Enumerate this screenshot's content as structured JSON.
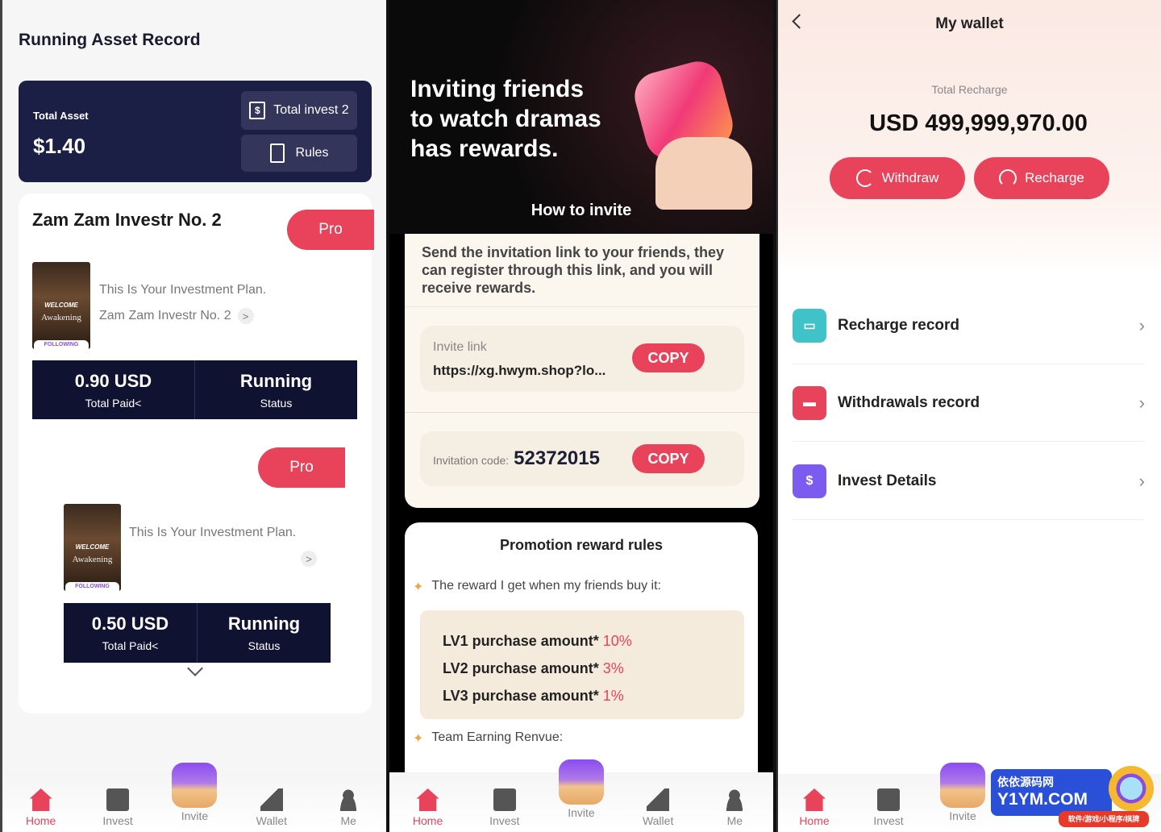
{
  "asset_record": {
    "title": "Running Asset Record",
    "total_asset_label": "Total Asset",
    "total_asset_value": "$1.40",
    "total_invest_label": "Total invest 2",
    "rules_label": "Rules",
    "plans": [
      {
        "name": "Zam Zam Investr No. 2",
        "pro_label": "Pro",
        "description": "This Is Your Investment Plan.",
        "plan_link": "Zam Zam Investr No. 2",
        "poster_text": "WELCOME",
        "poster_title": "Awakening",
        "poster_badge": "FOLLOWING",
        "paid_value": "0.90 USD",
        "paid_label": "Total Paid<",
        "status_value": "Running",
        "status_label": "Status"
      },
      {
        "name": "",
        "pro_label": "Pro",
        "description": "This Is Your Investment Plan.",
        "plan_link": "",
        "poster_text": "WELCOME",
        "poster_title": "Awakening",
        "poster_badge": "FOLLOWING",
        "paid_value": "0.50 USD",
        "paid_label": "Total Paid<",
        "status_value": "Running",
        "status_label": "Status"
      }
    ]
  },
  "invite": {
    "hero_title_lines": [
      "Inviting friends",
      "to watch dramas",
      "has rewards."
    ],
    "how_to": "How to invite",
    "instructions": "Send the invitation link to your friends, they can register through this link, and you will receive rewards.",
    "link_label": "Invite link",
    "link_value": "https://xg.hwym.shop?lo...",
    "copy_label": "COPY",
    "code_label": "Invitation code:",
    "code_value": "52372015",
    "rules_title": "Promotion reward rules",
    "reward_intro": "The reward I get when my friends buy it:",
    "levels": [
      {
        "label": "LV1 purchase amount*",
        "pct": "10%"
      },
      {
        "label": "LV2 purchase amount*",
        "pct": "3%"
      },
      {
        "label": "LV3 purchase amount*",
        "pct": "1%"
      }
    ],
    "team_label": "Team Earning Renvue:"
  },
  "wallet": {
    "title": "My wallet",
    "total_label": "Total Recharge",
    "total_value": "USD 499,999,970.00",
    "withdraw_label": "Withdraw",
    "recharge_label": "Recharge",
    "rows": [
      {
        "label": "Recharge record",
        "icon": "wallet-icon",
        "color": "#3fc3c9"
      },
      {
        "label": "Withdrawals record",
        "icon": "card-icon",
        "color": "#e9435b"
      },
      {
        "label": "Invest Details",
        "icon": "dollar-doc-icon",
        "color": "#7b5bf0"
      }
    ]
  },
  "tabs": [
    "Home",
    "Invest",
    "Invite",
    "Wallet",
    "Me"
  ],
  "watermark": {
    "line1": "依依源码网",
    "line2": "Y1YM.COM",
    "line3": "软件/游戏/小程序/棋牌"
  },
  "colors": {
    "accent": "#e9435b",
    "navy": "#1c1f45",
    "cream": "#fbf6ee"
  }
}
